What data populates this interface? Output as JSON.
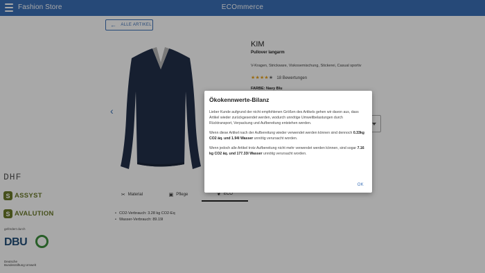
{
  "appbar": {
    "brand": "Fashion Store",
    "center_title": "ECOmmerce"
  },
  "back_button": {
    "label": "ALLE ARTIKEL"
  },
  "product": {
    "title": "KIM",
    "subtitle": "Pullover langarm",
    "description": "V-Kragen, Strickware, Viskosemischung, Stickerei, Casual sportiv",
    "rating_stars": 4,
    "reviews": "18 Bewertungen",
    "color_label": "FARBE: Navy Blu"
  },
  "logos": {
    "dhf": "DHF",
    "assyst": "ASSYST",
    "avalution": "AVALUTION",
    "gefoerdert": "gefördert durch",
    "dbu": "DBU",
    "dbu_sub_line1": "Deutsche",
    "dbu_sub_line2": "Bundesstiftung Umwelt"
  },
  "tabs": [
    {
      "label": "Material",
      "icon": "fabric-icon"
    },
    {
      "label": "Pflege",
      "icon": "care-icon"
    },
    {
      "label": "ECO",
      "icon": "leaf-icon"
    }
  ],
  "eco_values": [
    "CO2-Verbrauch: 3.28 kg CO2-Eq",
    "Wasser-Verbrauch: 89.19l"
  ],
  "dialog": {
    "title": "Ökokennwerte-Bilanz",
    "p1": "Lieber Kunde aufgrund der nicht empfohlenen Größen des Artikels gehen wir davon aus, dass Artikel wieder zurückgesendet werden, wodurch unnötige Umweltbelastungen durch Rücktransport, Verpackung und Aufbereitung entstehen werden.",
    "p2_pre": "Wenn diese Artikel nach der Aufbereitung wieder verwendet werden können sind dennoch ",
    "p2_bold": "0.33kg CO2 äq. und 1.94l Wasser",
    "p2_post": " unnötig verursacht worden.",
    "p3_pre": "Wenn jedoch alle Artikel trotz Aufbereitung nicht mehr verwendet werden können, sind sogar ",
    "p3_bold": "7.16 kg CO2 äq. und 177.33l Wasser",
    "p3_post": " unnötig verursacht worden.",
    "ok": "OK"
  },
  "colors": {
    "primary": "#3a6fb6",
    "star": "#e9a21a",
    "logo_green": "#6b7a2a",
    "dbu_blue": "#244f7a"
  }
}
